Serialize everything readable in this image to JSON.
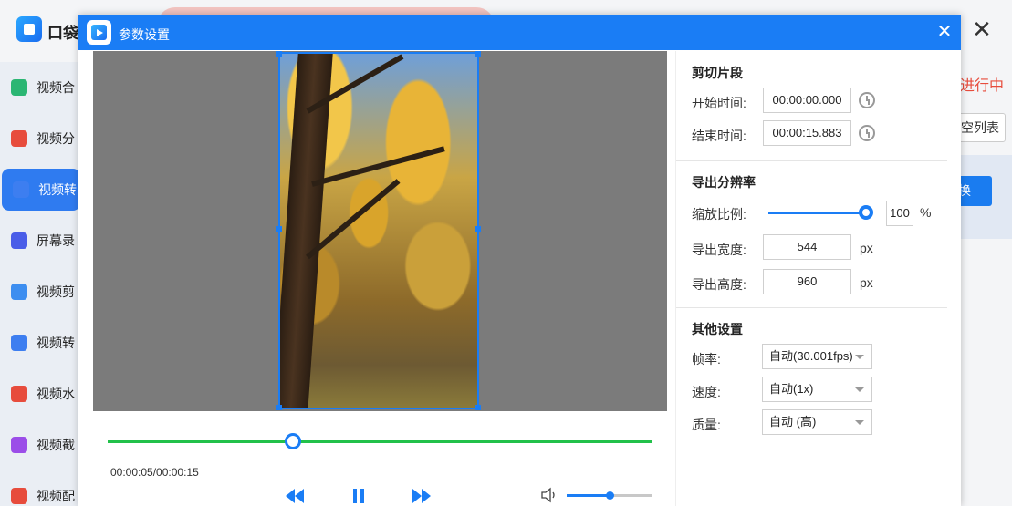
{
  "app": {
    "title": "口袋",
    "status_text": "进行中",
    "clear_list_label": "空列表",
    "start_button_label": "换"
  },
  "sidebar": {
    "items": [
      {
        "label": "视频合",
        "color": "#2bb673",
        "active": false
      },
      {
        "label": "视频分",
        "color": "#e74c3c",
        "active": false
      },
      {
        "label": "视频转",
        "color": "#3d7ef0",
        "active": true
      },
      {
        "label": "屏幕录",
        "color": "#4a5de8",
        "active": false
      },
      {
        "label": "视频剪",
        "color": "#3d8ef0",
        "active": false
      },
      {
        "label": "视频转",
        "color": "#3d7ef0",
        "active": false
      },
      {
        "label": "视频水",
        "color": "#e74c3c",
        "active": false
      },
      {
        "label": "视频截",
        "color": "#9b4de8",
        "active": false
      },
      {
        "label": "视频配",
        "color": "#e74c3c",
        "active": false
      }
    ]
  },
  "dialog": {
    "title": "参数设置",
    "player": {
      "time_display": "00:00:05/00:00:15",
      "progress_fraction": 0.34,
      "volume_fraction": 0.5
    },
    "settings": {
      "clip_section": {
        "title": "剪切片段",
        "start_label": "开始时间:",
        "start_value": "00:00:00.000",
        "end_label": "结束时间:",
        "end_value": "00:00:15.883"
      },
      "resolution_section": {
        "title": "导出分辨率",
        "scale_label": "缩放比例:",
        "scale_value": "100",
        "scale_unit": "%",
        "width_label": "导出宽度:",
        "width_value": "544",
        "height_label": "导出高度:",
        "height_value": "960",
        "px_unit": "px"
      },
      "other_section": {
        "title": "其他设置",
        "fps_label": "帧率:",
        "fps_value": "自动(30.001fps)",
        "speed_label": "速度:",
        "speed_value": "自动(1x)",
        "quality_label": "质量:",
        "quality_value": "自动 (高)"
      }
    }
  },
  "colors": {
    "accent": "#1a7df5",
    "progress": "#22c14a"
  }
}
